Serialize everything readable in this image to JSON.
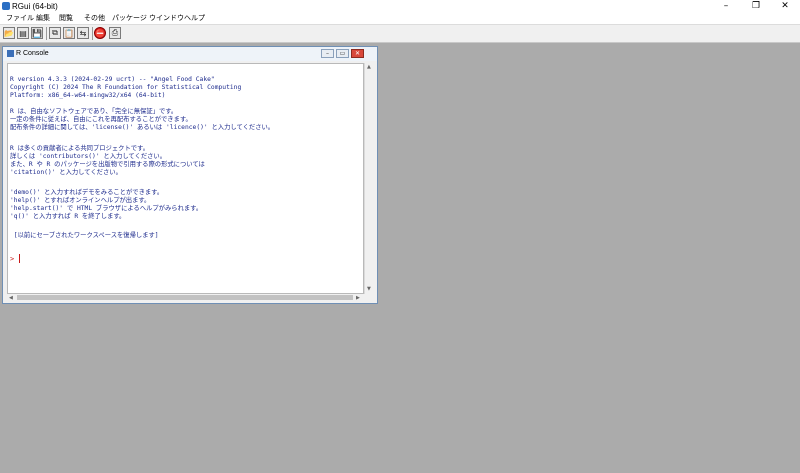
{
  "window": {
    "title": "RGui (64-bit)",
    "minimize": "–",
    "restore": "❐",
    "close": "✕"
  },
  "menu": [
    "ファイル",
    "編集",
    "閲覧",
    "その他",
    "パッケージ",
    "ウインドウ",
    "ヘルプ"
  ],
  "toolbar": [
    {
      "name": "open-script-icon",
      "glyph": "📂"
    },
    {
      "name": "load-workspace-icon",
      "glyph": "▤"
    },
    {
      "name": "save-workspace-icon",
      "glyph": "💾"
    },
    {
      "name": "copy-icon",
      "glyph": "⧉"
    },
    {
      "name": "paste-icon",
      "glyph": "📋"
    },
    {
      "name": "copy-paste-icon",
      "glyph": "⇆"
    },
    {
      "name": "stop-icon",
      "glyph": "⛔"
    },
    {
      "name": "print-icon",
      "glyph": "⎙"
    }
  ],
  "console": {
    "title": "R Console",
    "lines": [
      "R version 4.3.3 (2024-02-29 ucrt) -- \"Angel Food Cake\"",
      "Copyright (C) 2024 The R Foundation for Statistical Computing",
      "Platform: x86_64-w64-mingw32/x64 (64-bit)",
      "",
      "R は、自由なソフトウェアであり、「完全に無保証」です。",
      "一定の条件に従えば、自由にこれを再配布することができます。",
      "配布条件の詳細に関しては、'license()' あるいは 'licence()' と入力してください。",
      "",
      "R は多くの貢献者による共同プロジェクトです。",
      "詳しくは 'contributors()' と入力してください。",
      "また、R や R のパッケージを出版物で引用する際の形式については",
      "'citation()' と入力してください。",
      "",
      "'demo()' と入力すればデモをみることができます。",
      "'help()' とすればオンラインヘルプが出ます。",
      "'help.start()' で HTML ブラウザによるヘルプがみられます。",
      "'q()' と入力すれば R を終了します。",
      "",
      " [以前にセーブされたワークスペースを復帰します]"
    ],
    "prompt": ">"
  }
}
